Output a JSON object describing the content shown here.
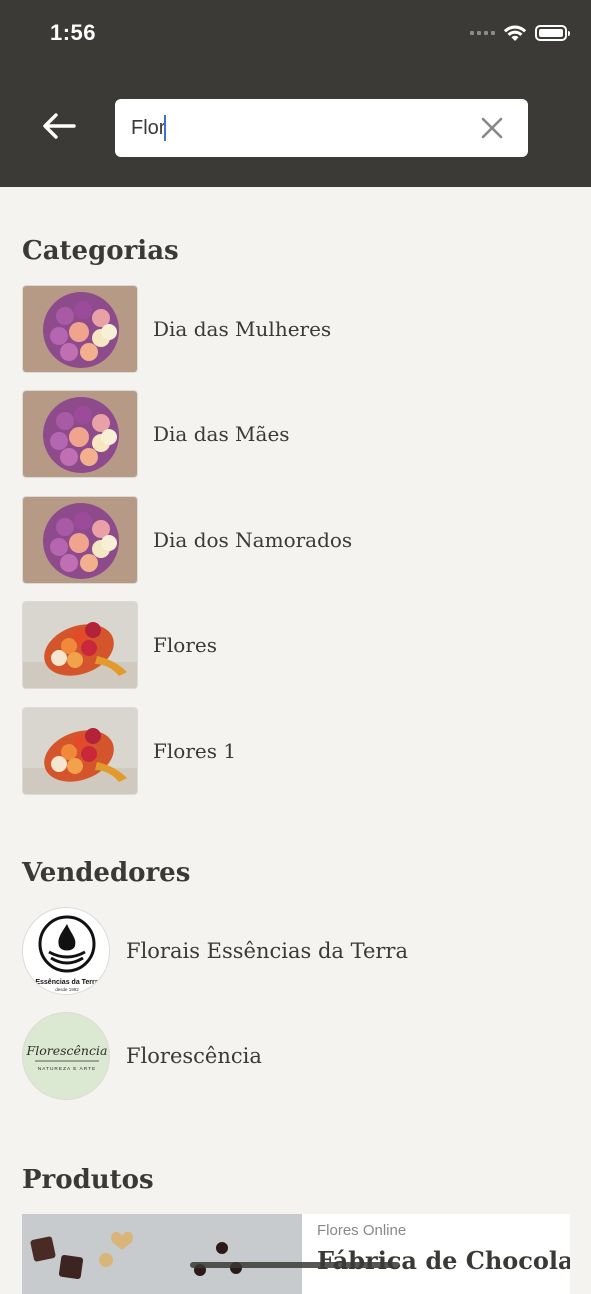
{
  "status": {
    "time": "1:56"
  },
  "search": {
    "value": "Flor"
  },
  "sections": {
    "categories_title": "Categorias",
    "vendors_title": "Vendedores",
    "products_title": "Produtos"
  },
  "categories": [
    {
      "label": "Dia das Mulheres",
      "image": "rose-bouquet-purple"
    },
    {
      "label": "Dia das Mães",
      "image": "rose-bouquet-purple"
    },
    {
      "label": "Dia dos Namorados",
      "image": "rose-bouquet-purple"
    },
    {
      "label": "Flores",
      "image": "rose-bouquet-orange"
    },
    {
      "label": "Flores 1",
      "image": "rose-bouquet-orange"
    }
  ],
  "vendors": [
    {
      "label": "Florais Essências da Terra",
      "logo_text": "Essências da Terra",
      "logo_sub": "desde 1992"
    },
    {
      "label": "Florescência",
      "logo_text": "Florescência",
      "logo_sub": "NATUREZA E ARTE"
    }
  ],
  "products": [
    {
      "store": "Flores Online",
      "name": "Fábrica de Chocolate"
    }
  ],
  "colors": {
    "topbar": "#3c3a36",
    "background": "#f4f3f0",
    "text": "#3a3935",
    "caret": "#3b6fd6"
  }
}
